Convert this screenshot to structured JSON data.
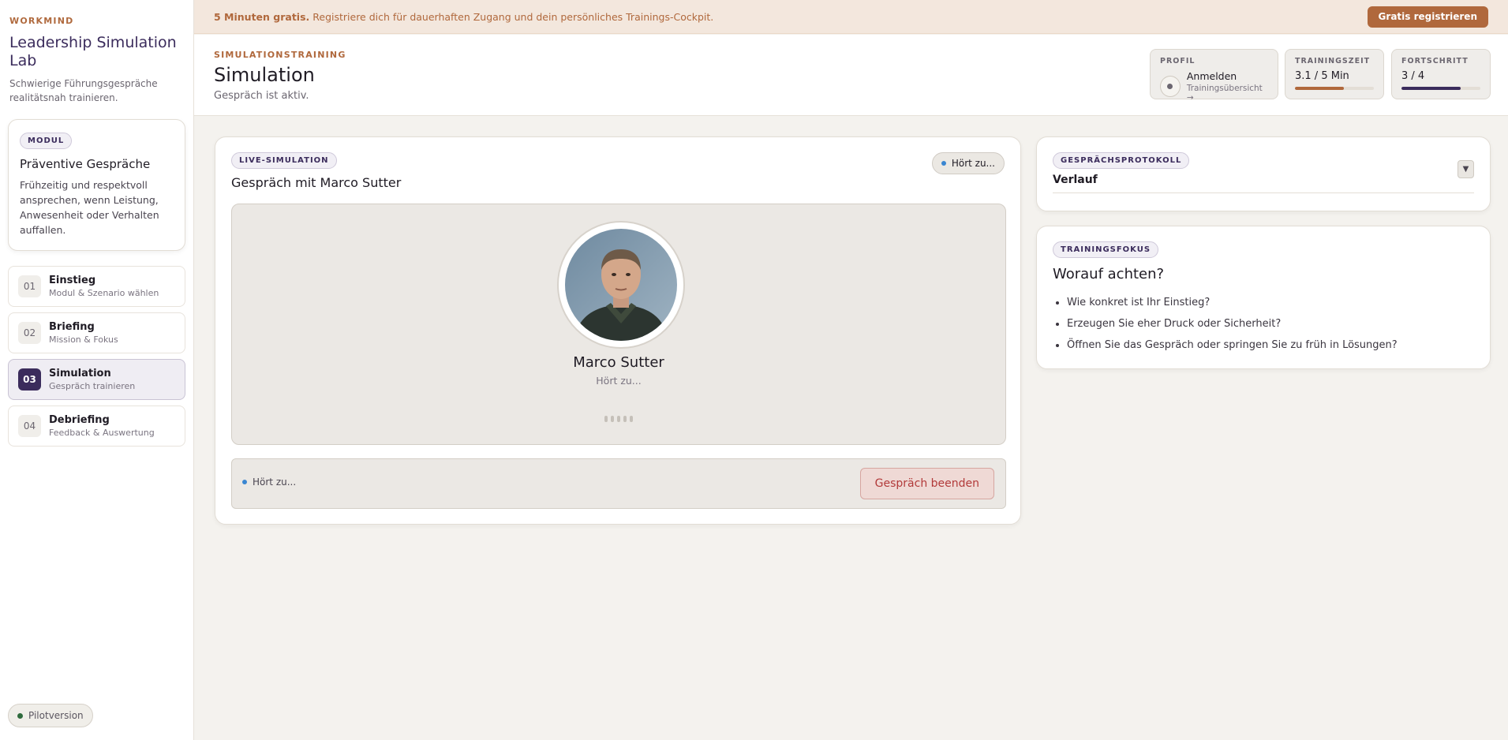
{
  "sidebar": {
    "brand_kicker": "WORKMIND",
    "brand_title": "Leadership Simulation Lab",
    "brand_subtitle": "Schwierige Führungsgespräche realitätsnah trainieren.",
    "module": {
      "badge": "MODUL",
      "title": "Präventive Gespräche",
      "description": "Frühzeitig und respektvoll ansprechen, wenn Leistung, Anwesenheit oder Verhalten auffallen."
    },
    "steps": [
      {
        "num": "01",
        "title": "Einstieg",
        "subtitle": "Modul & Szenario wählen"
      },
      {
        "num": "02",
        "title": "Briefing",
        "subtitle": "Mission & Fokus"
      },
      {
        "num": "03",
        "title": "Simulation",
        "subtitle": "Gespräch trainieren",
        "active": true
      },
      {
        "num": "04",
        "title": "Debriefing",
        "subtitle": "Feedback & Auswertung"
      }
    ],
    "pilot_label": "Pilotversion"
  },
  "banner": {
    "bold": "5 Minuten gratis.",
    "text": " Registriere dich für dauerhaften Zugang und dein persönliches Trainings-Cockpit.",
    "button": "Gratis registrieren"
  },
  "header": {
    "kicker": "SIMULATIONSTRAINING",
    "title": "Simulation",
    "subtitle": "Gespräch ist aktiv.",
    "profile": {
      "label": "PROFIL",
      "name": "Anmelden",
      "sub": "Trainingsübersicht →"
    },
    "time": {
      "label": "TRAININGSZEIT",
      "value": "3.1 / 5 Min",
      "progress": 0.62,
      "color": "#b0683c"
    },
    "progress": {
      "label": "FORTSCHRITT",
      "value": "3 / 4",
      "progress": 0.75,
      "color": "#3b2c5c"
    }
  },
  "simulation": {
    "badge": "LIVE-SIMULATION",
    "title": "Gespräch mit Marco Sutter",
    "status": "Hört zu...",
    "persona_name": "Marco Sutter",
    "persona_status": "Hört zu...",
    "controls_status": "Hört zu...",
    "end_button": "Gespräch beenden"
  },
  "protocol": {
    "badge": "GESPRÄCHSPROTOKOLL",
    "title": "Verlauf"
  },
  "focus": {
    "badge": "TRAININGSFOKUS",
    "title": "Worauf achten?",
    "items": [
      "Wie konkret ist Ihr Einstieg?",
      "Erzeugen Sie eher Druck oder Sicherheit?",
      "Öffnen Sie das Gespräch oder springen Sie zu früh in Lösungen?"
    ]
  },
  "colors": {
    "accent": "#b0683c",
    "brand": "#3b2c5c",
    "listening": "#3a86d1",
    "danger": "#b23a3a"
  }
}
